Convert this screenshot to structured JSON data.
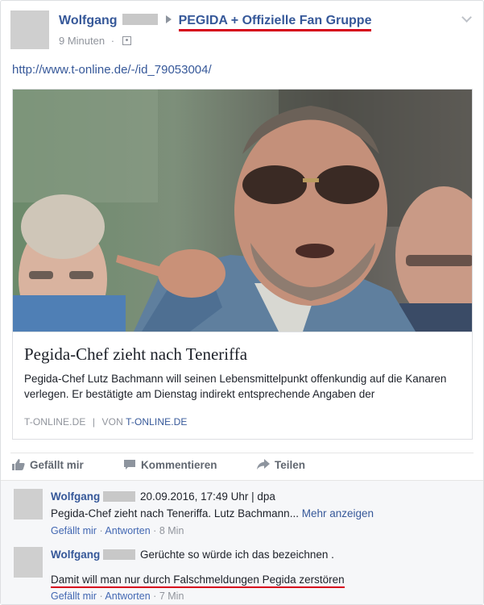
{
  "post": {
    "author": "Wolfgang",
    "group": "PEGIDA + Offizielle Fan Gruppe",
    "timestamp": "9 Minuten",
    "link_text": "http://www.t-online.de/-/id_79053004/",
    "card": {
      "title": "Pegida-Chef zieht nach Teneriffa",
      "description": "Pegida-Chef Lutz Bachmann will seinen Lebensmittelpunkt offenkundig auf die Kanaren verlegen. Er bestätigte am Dienstag indirekt entsprechende Angaben der",
      "source_domain": "T-ONLINE.DE",
      "source_sep": "|",
      "source_by": "VON",
      "source_link": "T-ONLINE.DE"
    }
  },
  "actions": {
    "like": "Gefällt mir",
    "comment": "Kommentieren",
    "share": "Teilen"
  },
  "comments": [
    {
      "author": "Wolfgang",
      "text": "20.09.2016, 17:49 Uhr | dpa",
      "text2": "Pegida-Chef zieht nach Teneriffa. Lutz Bachmann...",
      "more": "Mehr anzeigen",
      "like": "Gefällt mir",
      "sep1": "·",
      "reply": "Antworten",
      "sep2": "·",
      "time": "8 Min"
    },
    {
      "author": "Wolfgang",
      "text": "Gerüchte so würde ich das bezeichnen .",
      "text2": "Damit will man nur durch Falschmeldungen Pegida zerstören",
      "like": "Gefällt mir",
      "sep1": "·",
      "reply": "Antworten",
      "sep2": "·",
      "time": "7 Min"
    }
  ],
  "colors": {
    "link_blue": "#365899",
    "annotation_red": "#d6001c",
    "meta_gray": "#90949c"
  },
  "icons": {
    "dropdown": "chevron-down-icon",
    "audience": "audience-icon",
    "like": "thumbs-up-icon",
    "comment": "speech-bubble-icon",
    "share": "share-arrow-icon"
  }
}
